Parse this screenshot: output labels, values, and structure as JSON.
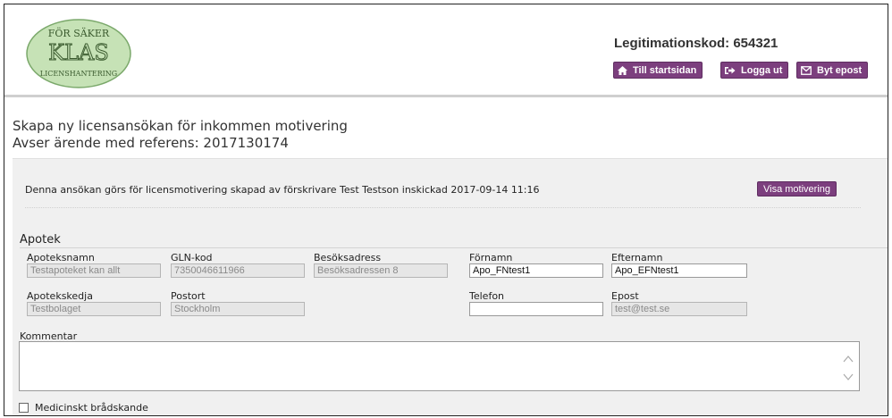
{
  "header": {
    "logo_text": {
      "top": "FÖR SÄKER",
      "middle": "KLAS",
      "bottom": "LICENSHANTERING"
    },
    "legitimation_label": "Legitimationskod: 654321",
    "buttons": [
      {
        "label": "Till startsidan",
        "icon": "home-icon"
      },
      {
        "label": "Logga ut",
        "icon": "logout-icon"
      },
      {
        "label": "Byt epost",
        "icon": "envelope-icon"
      }
    ]
  },
  "page": {
    "title": "Skapa ny licensansökan för inkommen motivering",
    "subtitle": "Avser ärende med referens: 2017130174"
  },
  "info": {
    "text": "Denna ansökan görs för licensmotivering skapad av förskrivare Test Testson inskickad 2017-09-14 11:16",
    "visa_button": "Visa motivering"
  },
  "apotek": {
    "section_title": "Apotek",
    "fields": {
      "apoteksnamn": {
        "label": "Apoteksnamn",
        "value": "Testapoteket kan allt"
      },
      "gln": {
        "label": "GLN-kod",
        "value": "7350046611966"
      },
      "besoksadress": {
        "label": "Besöksadress",
        "value": "Besöksadressen 8"
      },
      "fornamn": {
        "label": "Förnamn",
        "value": "Apo_FNtest1"
      },
      "efternamn": {
        "label": "Efternamn",
        "value": "Apo_EFNtest1"
      },
      "apotekskedja": {
        "label": "Apotekskedja",
        "value": "Testbolaget"
      },
      "postort": {
        "label": "Postort",
        "value": "Stockholm"
      },
      "telefon": {
        "label": "Telefon",
        "value": ""
      },
      "epost": {
        "label": "Epost",
        "value": "test@test.se"
      }
    },
    "kommentar_label": "Kommentar",
    "kommentar_value": "",
    "checkbox_label": "Medicinskt brådskande"
  },
  "colors": {
    "accent": "#7c3f7e",
    "logo_green": "#b8d9a8"
  }
}
